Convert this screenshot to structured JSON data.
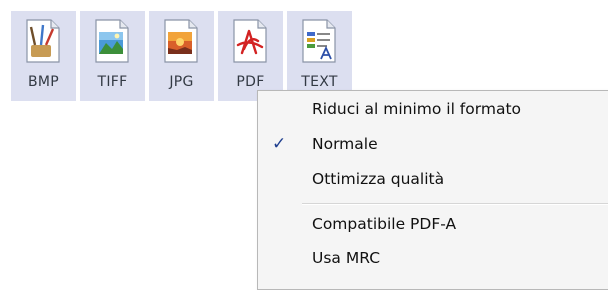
{
  "toolbar": {
    "buttons": [
      {
        "label": "BMP",
        "icon": "bmp-file-icon"
      },
      {
        "label": "TIFF",
        "icon": "tiff-file-icon"
      },
      {
        "label": "JPG",
        "icon": "jpg-file-icon"
      },
      {
        "label": "PDF",
        "icon": "pdf-file-icon"
      },
      {
        "label": "TEXT",
        "icon": "text-file-icon"
      }
    ]
  },
  "context_menu": {
    "items": [
      {
        "label": "Riduci al minimo il formato",
        "checked": false
      },
      {
        "label": "Normale",
        "checked": true
      },
      {
        "label": "Ottimizza qualità",
        "checked": false
      },
      {
        "label": "Compatibile PDF-A",
        "checked": false
      },
      {
        "label": "Usa MRC",
        "checked": false
      }
    ],
    "check_glyph": "✓"
  },
  "colors": {
    "button_bg": "#dcdff0",
    "menu_bg": "#f5f5f5",
    "check": "#1f3f8f"
  }
}
